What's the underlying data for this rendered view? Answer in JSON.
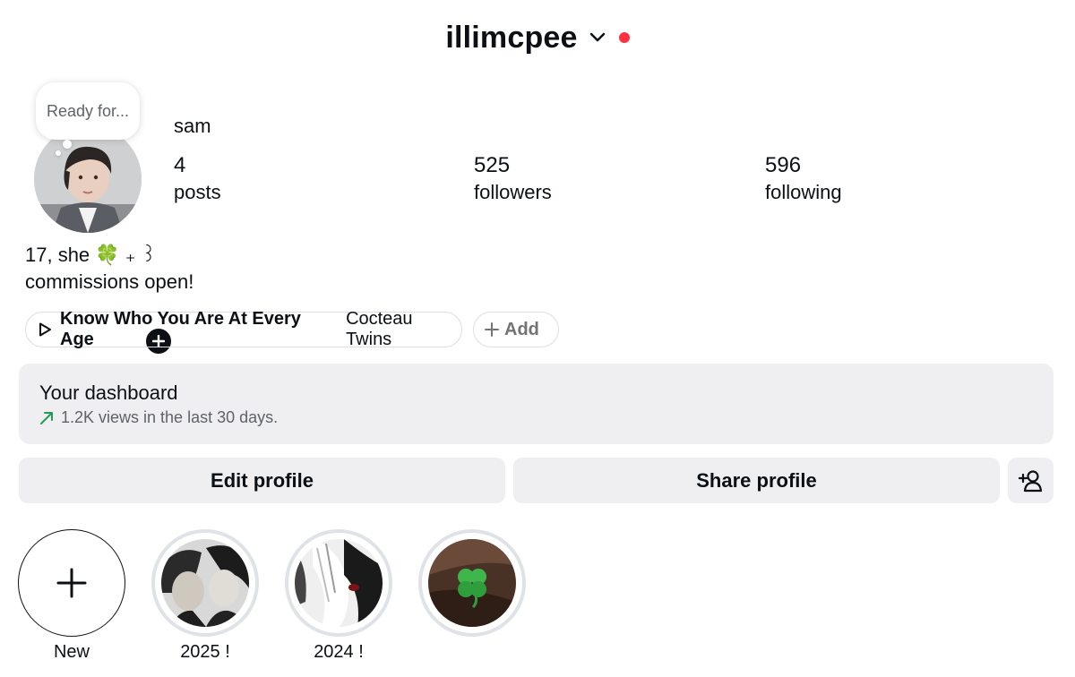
{
  "header": {
    "username": "illimcpee",
    "dropdown_icon": "chevron-down-icon",
    "notification_color": "#ff3040"
  },
  "profile": {
    "note": "Ready for...",
    "display_name": "sam",
    "stats": [
      {
        "count": "4",
        "label": "posts"
      },
      {
        "count": "525",
        "label": "followers"
      },
      {
        "count": "596",
        "label": "following"
      }
    ],
    "bio_line1": "17, she 🍀 ₊ ꒱",
    "bio_line2": "commissions open!"
  },
  "music": {
    "song": "Know Who You Are At Every Age",
    "artist": "Cocteau Twins",
    "add_label": "Add"
  },
  "dashboard": {
    "title": "Your dashboard",
    "subtitle": "1.2K views in the last 30 days.",
    "trend_color": "#1f9d55"
  },
  "actions": {
    "edit_label": "Edit profile",
    "share_label": "Share profile",
    "discover_icon": "add-person-icon"
  },
  "highlights": [
    {
      "label": "New"
    },
    {
      "label": "2025 !"
    },
    {
      "label": "2024 !"
    },
    {
      "label": ""
    }
  ]
}
